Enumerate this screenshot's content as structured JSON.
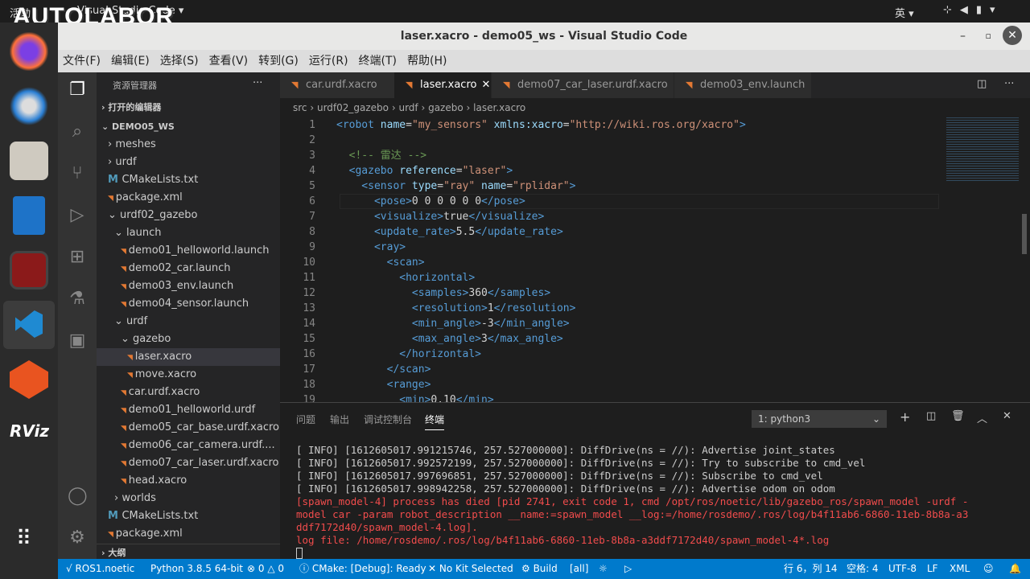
{
  "topbar": {
    "activities": "活动",
    "app": "Visual Studio Code ▾",
    "lang": "英 ▾",
    "logo": "AUTOLABOR"
  },
  "window": {
    "title": "laser.xacro - demo05_ws - Visual Studio Code"
  },
  "menu": [
    "文件(F)",
    "编辑(E)",
    "选择(S)",
    "查看(V)",
    "转到(G)",
    "运行(R)",
    "终端(T)",
    "帮助(H)"
  ],
  "dock": [
    "firefox",
    "thunderbird",
    "files",
    "libreoffice-writer",
    "terminal",
    "vscode",
    "ubuntu-software",
    "rviz",
    "show-apps"
  ],
  "dock_rviz": "RViz",
  "sidebar": {
    "title": "资源管理器",
    "more": "···",
    "open_editors": "打开的编辑器",
    "outline": "大纲",
    "items": [
      {
        "label": "DEMO05_WS",
        "indent": 0,
        "type": "root"
      },
      {
        "label": "meshes",
        "indent": 1,
        "type": "folder-closed"
      },
      {
        "label": "urdf",
        "indent": 1,
        "type": "folder-closed"
      },
      {
        "label": "CMakeLists.txt",
        "indent": 1,
        "type": "cmake"
      },
      {
        "label": "package.xml",
        "indent": 1,
        "type": "xml"
      },
      {
        "label": "urdf02_gazebo",
        "indent": 1,
        "type": "folder-open"
      },
      {
        "label": "launch",
        "indent": 2,
        "type": "folder-open"
      },
      {
        "label": "demo01_helloworld.launch",
        "indent": 3,
        "type": "xml"
      },
      {
        "label": "demo02_car.launch",
        "indent": 3,
        "type": "xml"
      },
      {
        "label": "demo03_env.launch",
        "indent": 3,
        "type": "xml"
      },
      {
        "label": "demo04_sensor.launch",
        "indent": 3,
        "type": "xml"
      },
      {
        "label": "urdf",
        "indent": 2,
        "type": "folder-open"
      },
      {
        "label": "gazebo",
        "indent": 3,
        "type": "folder-open"
      },
      {
        "label": "laser.xacro",
        "indent": 4,
        "type": "xml",
        "selected": true
      },
      {
        "label": "move.xacro",
        "indent": 4,
        "type": "xml"
      },
      {
        "label": "car.urdf.xacro",
        "indent": 3,
        "type": "xml"
      },
      {
        "label": "demo01_helloworld.urdf",
        "indent": 3,
        "type": "xml"
      },
      {
        "label": "demo05_car_base.urdf.xacro",
        "indent": 3,
        "type": "xml"
      },
      {
        "label": "demo06_car_camera.urdf....",
        "indent": 3,
        "type": "xml"
      },
      {
        "label": "demo07_car_laser.urdf.xacro",
        "indent": 3,
        "type": "xml"
      },
      {
        "label": "head.xacro",
        "indent": 3,
        "type": "xml"
      },
      {
        "label": "worlds",
        "indent": 2,
        "type": "folder-closed"
      },
      {
        "label": "CMakeLists.txt",
        "indent": 1,
        "type": "cmake"
      },
      {
        "label": "package.xml",
        "indent": 1,
        "type": "xml"
      }
    ]
  },
  "tabs": [
    {
      "label": "car.urdf.xacro"
    },
    {
      "label": "laser.xacro",
      "active": true
    },
    {
      "label": "demo07_car_laser.urdf.xacro"
    },
    {
      "label": "demo03_env.launch"
    }
  ],
  "breadcrumb": [
    "src",
    "urdf02_gazebo",
    "urdf",
    "gazebo",
    "laser.xacro"
  ],
  "code": [
    [
      [
        "t",
        "<robot "
      ],
      [
        "a",
        "name"
      ],
      [
        "",
        "="
      ],
      [
        "s",
        "\"my_sensors\""
      ],
      [
        "a",
        " xmlns:xacro"
      ],
      [
        "",
        "="
      ],
      [
        "s",
        "\"http://wiki.ros.org/xacro\""
      ],
      [
        "t",
        ">"
      ]
    ],
    [],
    [
      [
        "c",
        "  <!-- 雷达 -->"
      ]
    ],
    [
      [
        "t",
        "  <gazebo "
      ],
      [
        "a",
        "reference"
      ],
      [
        "",
        "="
      ],
      [
        "s",
        "\"laser\""
      ],
      [
        "t",
        ">"
      ]
    ],
    [
      [
        "t",
        "    <sensor "
      ],
      [
        "a",
        "type"
      ],
      [
        "",
        "="
      ],
      [
        "s",
        "\"ray\""
      ],
      [
        "a",
        " name"
      ],
      [
        "",
        "="
      ],
      [
        "s",
        "\"rplidar\""
      ],
      [
        "t",
        ">"
      ]
    ],
    [
      [
        "t",
        "      <pose>"
      ],
      [
        "",
        "0 0 0 0 0 0"
      ],
      [
        "t",
        "</pose>"
      ]
    ],
    [
      [
        "t",
        "      <visualize>"
      ],
      [
        "",
        "true"
      ],
      [
        "t",
        "</visualize>"
      ]
    ],
    [
      [
        "t",
        "      <update_rate>"
      ],
      [
        "",
        "5.5"
      ],
      [
        "t",
        "</update_rate>"
      ]
    ],
    [
      [
        "t",
        "      <ray>"
      ]
    ],
    [
      [
        "t",
        "        <scan>"
      ]
    ],
    [
      [
        "t",
        "          <horizontal>"
      ]
    ],
    [
      [
        "t",
        "            <samples>"
      ],
      [
        "",
        "360"
      ],
      [
        "t",
        "</samples>"
      ]
    ],
    [
      [
        "t",
        "            <resolution>"
      ],
      [
        "",
        "1"
      ],
      [
        "t",
        "</resolution>"
      ]
    ],
    [
      [
        "t",
        "            <min_angle>"
      ],
      [
        "",
        "-3"
      ],
      [
        "t",
        "</min_angle>"
      ]
    ],
    [
      [
        "t",
        "            <max_angle>"
      ],
      [
        "",
        "3"
      ],
      [
        "t",
        "</max_angle>"
      ]
    ],
    [
      [
        "t",
        "          </horizontal>"
      ]
    ],
    [
      [
        "t",
        "        </scan>"
      ]
    ],
    [
      [
        "t",
        "        <range>"
      ]
    ],
    [
      [
        "t",
        "          <min>"
      ],
      [
        "",
        "0.10"
      ],
      [
        "t",
        "</min>"
      ]
    ]
  ],
  "panel": {
    "tabs": [
      "问题",
      "输出",
      "调试控制台",
      "终端"
    ],
    "active": "终端",
    "terminal_select": "1: python3",
    "lines": [
      {
        "text": "[ INFO] [1612605017.991215746, 257.527000000]: DiffDrive(ns = //): Advertise joint_states",
        "err": false
      },
      {
        "text": "[ INFO] [1612605017.992572199, 257.527000000]: DiffDrive(ns = //): Try to subscribe to cmd_vel",
        "err": false
      },
      {
        "text": "[ INFO] [1612605017.997696851, 257.527000000]: DiffDrive(ns = //): Subscribe to cmd_vel",
        "err": false
      },
      {
        "text": "[ INFO] [1612605017.998942258, 257.527000000]: DiffDrive(ns = //): Advertise odom on odom",
        "err": false
      },
      {
        "text": "[spawn_model-4] process has died [pid 2741, exit code 1, cmd /opt/ros/noetic/lib/gazebo_ros/spawn_model -urdf -",
        "err": true
      },
      {
        "text": "model car -param robot_description __name:=spawn_model __log:=/home/rosdemo/.ros/log/b4f11ab6-6860-11eb-8b8a-a3",
        "err": true
      },
      {
        "text": "ddf7172d40/spawn_model-4.log].",
        "err": true
      },
      {
        "text": "log file: /home/rosdemo/.ros/log/b4f11ab6-6860-11eb-8b8a-a3ddf7172d40/spawn_model-4*.log",
        "err": true
      }
    ]
  },
  "status": {
    "ros": "√ ROS1.noetic",
    "python": "Python 3.8.5 64-bit",
    "problems": "⊗ 0 △ 0",
    "cmake": "ⓘ CMake: [Debug]: Ready",
    "kit": "✕ No Kit Selected",
    "build": "⚙ Build",
    "target": "[all]",
    "position": "行 6，列 14",
    "spaces": "空格: 4",
    "encoding": "UTF-8",
    "eol": "LF",
    "lang": "XML"
  },
  "colors": {
    "statusbar": "#007acc",
    "accent": "#e37933"
  }
}
